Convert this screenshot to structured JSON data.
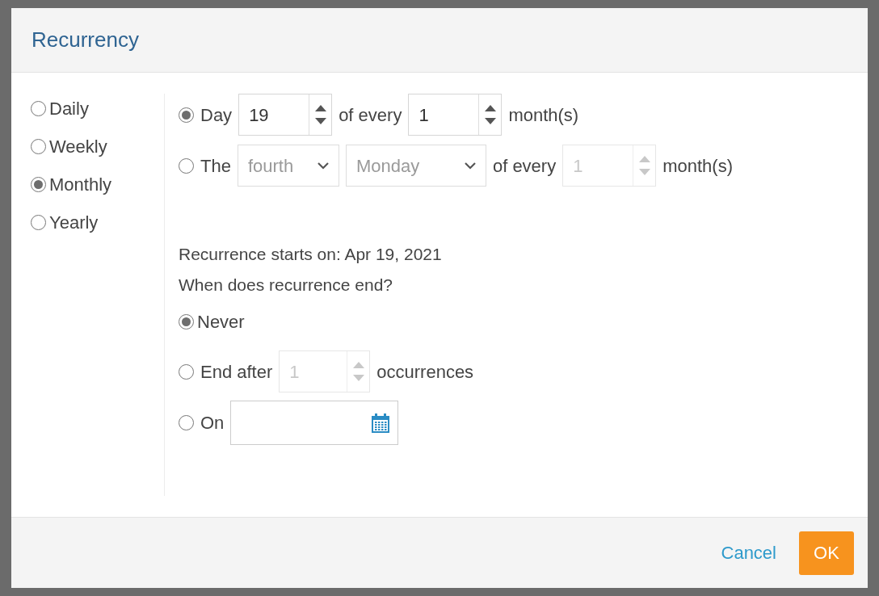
{
  "dialog": {
    "title": "Recurrency"
  },
  "frequencies": [
    {
      "label": "Daily",
      "selected": false
    },
    {
      "label": "Weekly",
      "selected": false
    },
    {
      "label": "Monthly",
      "selected": true
    },
    {
      "label": "Yearly",
      "selected": false
    }
  ],
  "monthly_options": [
    {
      "kind": "day",
      "selected": true,
      "disabled": false,
      "label": "Day",
      "day": "19",
      "of_every": "of every",
      "interval": "1",
      "unit": "month(s)"
    },
    {
      "kind": "weekday",
      "selected": false,
      "disabled": true,
      "label": "The",
      "ordinal": "fourth",
      "weekday": "Monday",
      "of_every": "of every",
      "interval": "1",
      "unit": "month(s)"
    }
  ],
  "starts_text": "Recurrence starts on: Apr 19, 2021",
  "end_question": "When does recurrence end?",
  "end_options": [
    {
      "kind": "never",
      "label": "Never",
      "selected": true
    },
    {
      "kind": "after",
      "label": "End after",
      "count": "1",
      "unit": "occurrences",
      "selected": false,
      "disabled": true
    },
    {
      "kind": "on",
      "label": "On",
      "selected": false
    }
  ],
  "buttons": [
    {
      "kind": "link",
      "label": "Cancel"
    },
    {
      "kind": "primary",
      "label": "OK"
    }
  ]
}
